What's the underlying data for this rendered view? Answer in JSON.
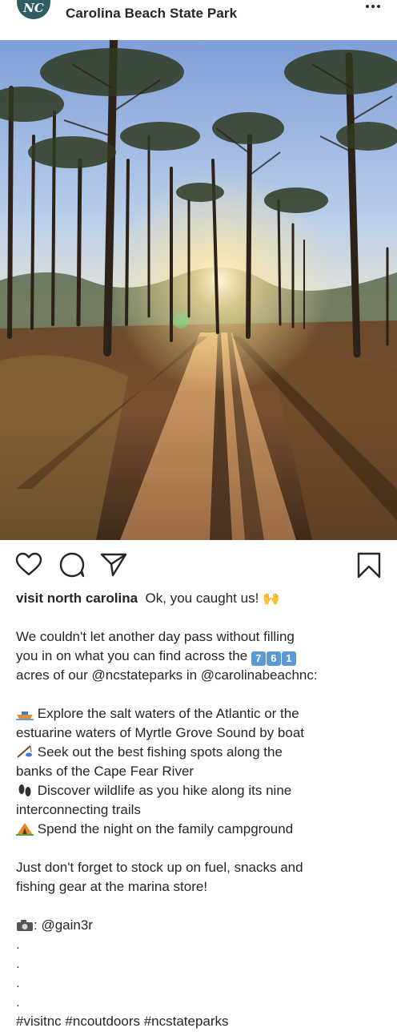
{
  "header": {
    "avatar_text": "NC",
    "account_name": "Carolina Beach State Park",
    "more_icon": "more-horizontal-icon"
  },
  "post": {
    "photo_icon": "forest-trail-photo",
    "actions": {
      "like_icon": "heart-icon",
      "comment_icon": "comment-icon",
      "share_icon": "paper-plane-icon",
      "save_icon": "bookmark-icon"
    }
  },
  "caption": {
    "username": "visit north carolina",
    "intro": "Ok, you caught us! 🙌",
    "p1_line1": "We couldn't let another day pass without filling",
    "p1_line2": "you in on what you can find across the",
    "acres_digits": [
      "7",
      "6",
      "1"
    ],
    "p1_line3": "acres of our @ncstateparks in @carolinabeachnc:",
    "b1_line1": "Explore the salt waters of the Atlantic or the",
    "b1_line2": "estuarine waters of Myrtle Grove Sound by boat",
    "b2_line1": "Seek out the best fishing spots along the",
    "b2_line2": "banks of the Cape Fear River",
    "b3_line1": "Discover wildlife as you hike along its nine",
    "b3_line2": "interconnecting trails",
    "b4_line1": "Spend the night on the family campground",
    "p2_line1": "Just don't forget to stock up on fuel, snacks and",
    "p2_line2": "fishing gear at the marina store!",
    "credit": ": @gain3r",
    "dot": ".",
    "hashtags": "#visitnc #ncoutdoors #ncstateparks"
  },
  "colors": {
    "text": "#262626",
    "brand": "#2e5d62"
  }
}
